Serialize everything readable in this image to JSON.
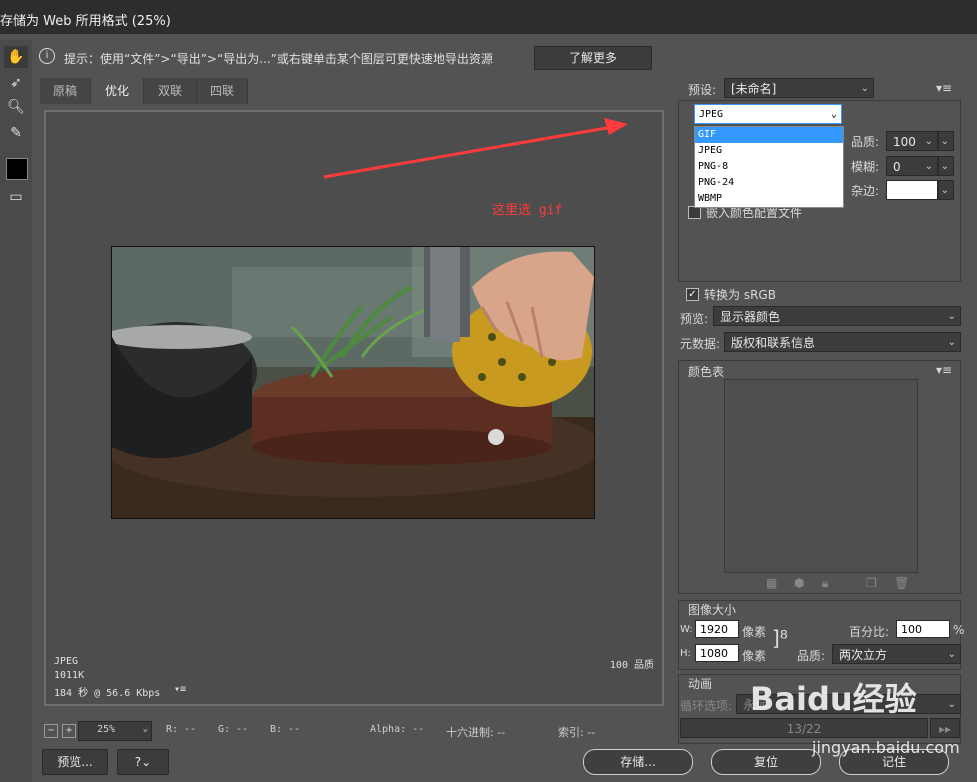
{
  "window": {
    "title": "存储为 Web 所用格式 (25%)"
  },
  "hint": {
    "text": "提示：使用“文件”>“导出”>“导出为...”或右键单击某个图层可更快速地导出资源",
    "learn_more": "了解更多"
  },
  "tabs": [
    {
      "label": "原稿",
      "active": false
    },
    {
      "label": "优化",
      "active": true
    },
    {
      "label": "双联",
      "active": false
    },
    {
      "label": "四联",
      "active": false
    }
  ],
  "annotation": {
    "text": "这里选 gif",
    "color": "#ff3b3b"
  },
  "image_info": {
    "format": "JPEG",
    "size": "1011K",
    "time": "184 秒 @ 56.6 Kbps",
    "quality": "100 品质"
  },
  "status": {
    "zoom": "25%",
    "r": "R: --",
    "g": "G: --",
    "b": "B: --",
    "alpha": "Alpha: --",
    "hex": "十六进制: --",
    "index": "索引: --"
  },
  "buttons": {
    "preview": "预览...",
    "save": "存储...",
    "reset": "复位",
    "remember": "记住"
  },
  "settings": {
    "preset_label": "预设:",
    "preset_value": "[未命名]",
    "format_value": "JPEG",
    "format_options": [
      "GIF",
      "JPEG",
      "PNG-8",
      "PNG-24",
      "WBMP"
    ],
    "highlighted_option": "GIF",
    "quality_label": "品质:",
    "quality_value": "100",
    "blur_label": "模糊:",
    "blur_value": "0",
    "matte_label": "杂边:",
    "embed_profile": "嵌入颜色配置文件",
    "convert_srgb": "转换为 sRGB",
    "preview_label": "预览:",
    "preview_value": "显示器颜色",
    "metadata_label": "元数据:",
    "metadata_value": "版权和联系信息"
  },
  "color_table": {
    "title": "颜色表"
  },
  "image_size": {
    "title": "图像大小",
    "w_label": "W:",
    "w_value": "1920",
    "h_label": "H:",
    "h_value": "1080",
    "unit": "像素",
    "percent_label": "百分比:",
    "percent_value": "100",
    "percent_unit": "%",
    "quality_label": "品质:",
    "quality_value": "两次立方"
  },
  "animation": {
    "title": "动画",
    "loop_label": "循环选项:",
    "loop_value": "永远",
    "frame": "13/22"
  },
  "watermark": {
    "brand": "Baidu经验",
    "url": "jingyan.baidu.com"
  }
}
